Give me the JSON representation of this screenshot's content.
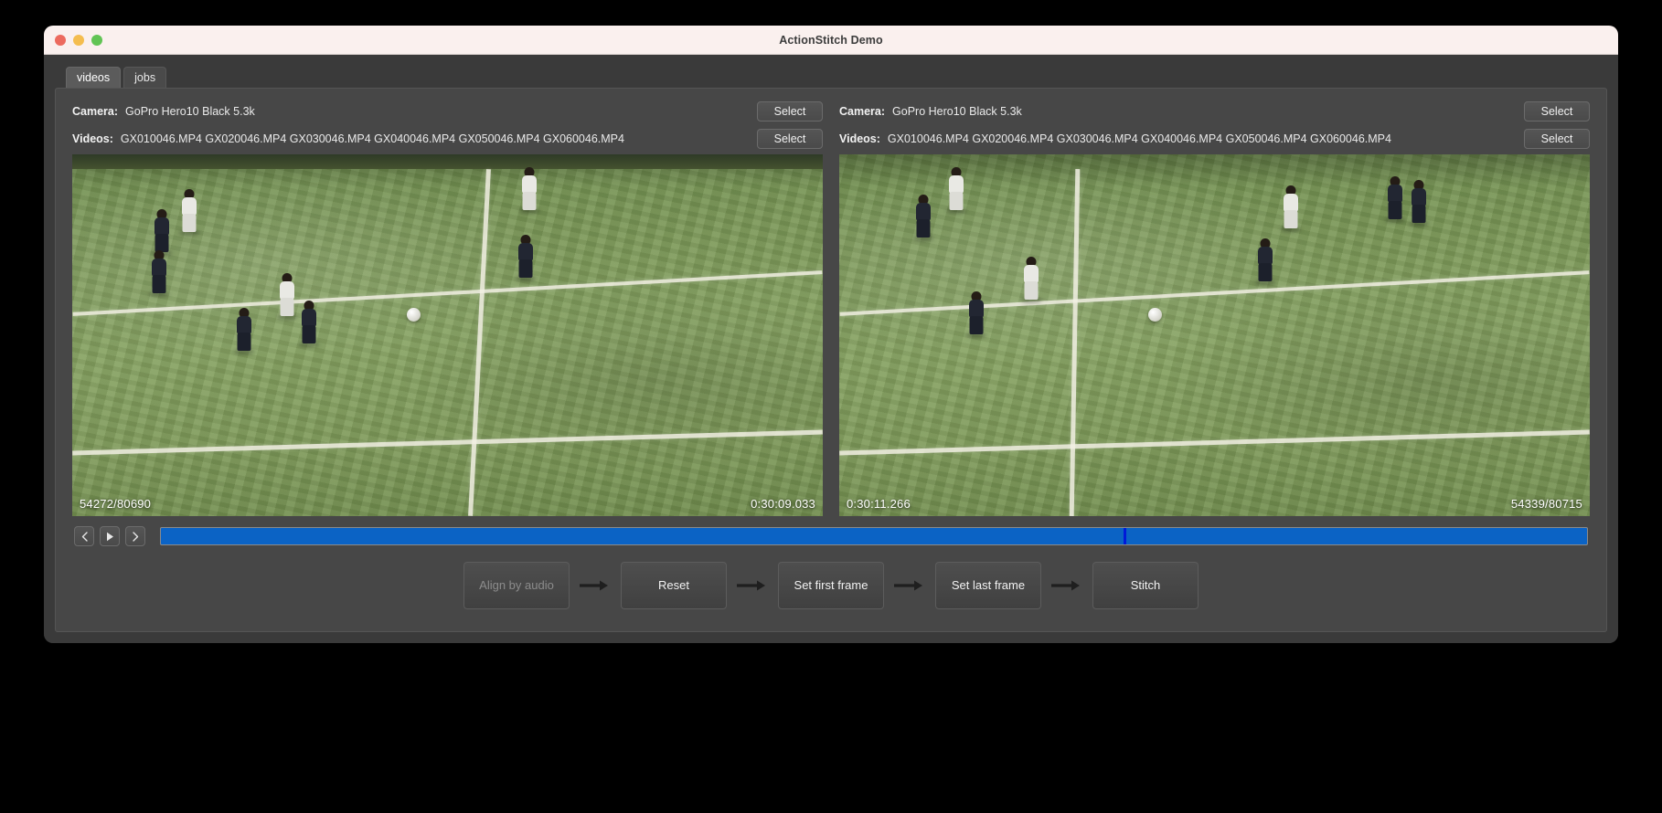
{
  "window": {
    "title": "ActionStitch Demo",
    "traffic_lights": [
      {
        "name": "close-button",
        "color": "#ec6a5e"
      },
      {
        "name": "minimize-button",
        "color": "#f4bd4f"
      },
      {
        "name": "maximize-button",
        "color": "#61c454"
      }
    ]
  },
  "tabs": [
    {
      "id": "videos",
      "label": "videos",
      "active": true
    },
    {
      "id": "jobs",
      "label": "jobs",
      "active": false
    }
  ],
  "panes": [
    {
      "id": "left",
      "camera_label": "Camera:",
      "camera_value": "GoPro Hero10 Black 5.3k",
      "camera_select_label": "Select",
      "videos_label": "Videos:",
      "videos_value": "GX010046.MP4 GX020046.MP4 GX030046.MP4 GX040046.MP4 GX050046.MP4 GX060046.MP4",
      "videos_select_label": "Select",
      "overlay_left": "54272/80690",
      "overlay_right": "0:30:09.033"
    },
    {
      "id": "right",
      "camera_label": "Camera:",
      "camera_value": "GoPro Hero10 Black 5.3k",
      "camera_select_label": "Select",
      "videos_label": "Videos:",
      "videos_value": "GX010046.MP4 GX020046.MP4 GX030046.MP4 GX040046.MP4 GX050046.MP4 GX060046.MP4",
      "videos_select_label": "Select",
      "overlay_left": "0:30:11.266",
      "overlay_right": "54339/80715"
    }
  ],
  "transport": {
    "prev_icon": "chevron-left-icon",
    "play_icon": "play-icon",
    "next_icon": "chevron-right-icon",
    "slider_fill_color": "#0b63c5",
    "slider_handle_color": "#0019d9",
    "slider_handle_percent": 67.5
  },
  "actions": [
    {
      "id": "align-by-audio",
      "label": "Align by audio",
      "disabled": true
    },
    {
      "id": "reset",
      "label": "Reset",
      "disabled": false
    },
    {
      "id": "set-first-frame",
      "label": "Set first frame",
      "disabled": false
    },
    {
      "id": "set-last-frame",
      "label": "Set last frame",
      "disabled": false
    },
    {
      "id": "stitch",
      "label": "Stitch",
      "disabled": false
    }
  ],
  "theme": {
    "window_bg": "#2b2b2b",
    "body_bg": "#3a3a3a",
    "panel_bg": "#474747",
    "titlebar_bg": "#faf0ee",
    "accent": "#0b63c5"
  }
}
